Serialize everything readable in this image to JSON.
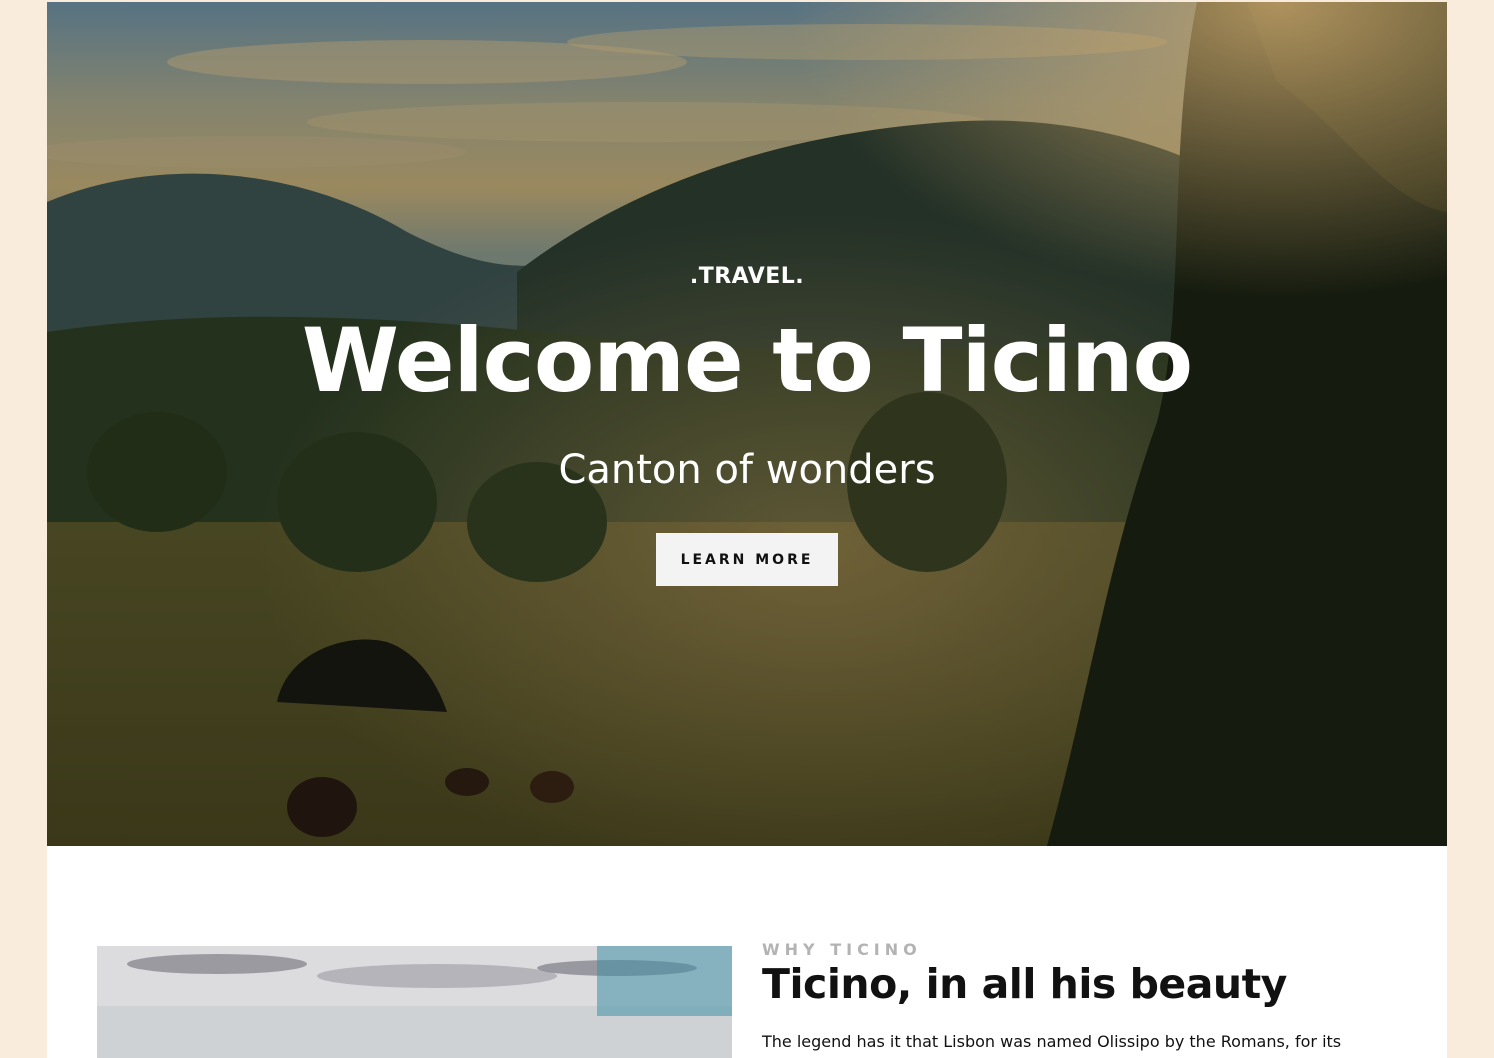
{
  "hero": {
    "brand": ".TRAVEL.",
    "title": "Welcome to Ticino",
    "subtitle": "Canton of wonders",
    "button_label": "LEARN MORE"
  },
  "intro": {
    "eyebrow": "WHY TICINO",
    "title": "Ticino, in all his beauty",
    "body": "The legend has it that Lisbon was named Olissipo by the Romans, for its"
  },
  "colors": {
    "page_background": "#faecdc",
    "button_background": "#f3f3f3",
    "eyebrow": "#b3b3b3",
    "text": "#111111"
  }
}
